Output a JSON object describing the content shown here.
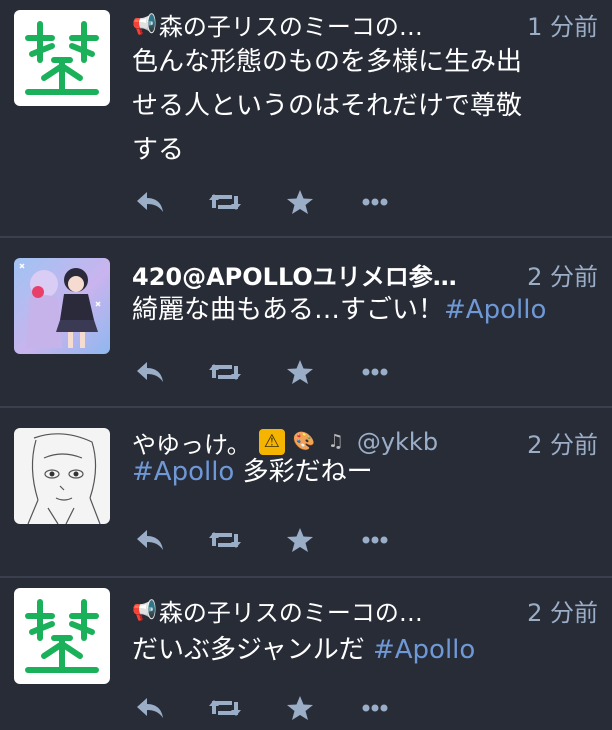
{
  "colors": {
    "background": "#282c37",
    "text": "#ffffff",
    "muted": "#9baec8",
    "hashtag": "#6e98d6",
    "divider": "#393f4f"
  },
  "statuses": [
    {
      "name": "森の子リスのミーコの…",
      "time": "1 分前",
      "content_line1": "色んな形態のものを多様に生み出",
      "content_line2": "せる人というのはそれだけで尊敬",
      "content_line3": "する",
      "avatar": "green-sprout-logo"
    },
    {
      "name": "420@APOLLOユリメロ参…",
      "time": "2 分前",
      "content_text": "綺麗な曲もある…すごい！",
      "hashtag": "#Apollo",
      "avatar": "anime-illustration"
    },
    {
      "name": "やゆっけ。",
      "account": "@ykkb",
      "time": "2 分前",
      "hashtag": "#Apollo",
      "content_text": " 多彩だねー",
      "avatar": "pencil-sketch"
    },
    {
      "name": "森の子リスのミーコの…",
      "time": "2 分前",
      "content_text": "だいぶ多ジャンルだ ",
      "hashtag": "#Apollo",
      "avatar": "green-sprout-logo"
    }
  ],
  "icons": {
    "reply": "reply-icon",
    "boost": "boost-icon",
    "favourite": "star-icon",
    "more": "more-icon",
    "megaphone": "megaphone-icon"
  }
}
